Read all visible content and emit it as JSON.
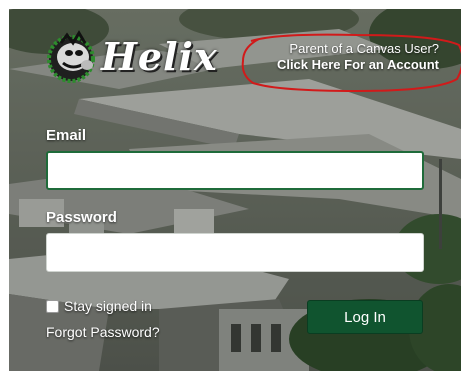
{
  "logo": {
    "wordmark": "Helix",
    "mascot_icon": "highlander-mascot-icon"
  },
  "parent_link": {
    "line1": "Parent of a Canvas User?",
    "line2": "Click Here For an Account",
    "annotation_color": "#d11a1a"
  },
  "form": {
    "email_label": "Email",
    "email_value": "",
    "password_label": "Password",
    "password_value": "",
    "stay_signed_in_label": "Stay signed in",
    "stay_signed_in_checked": false,
    "login_button_label": "Log In",
    "forgot_password_label": "Forgot Password?"
  },
  "colors": {
    "button_bg": "#10542f",
    "focus_border": "#1f6b3a"
  }
}
